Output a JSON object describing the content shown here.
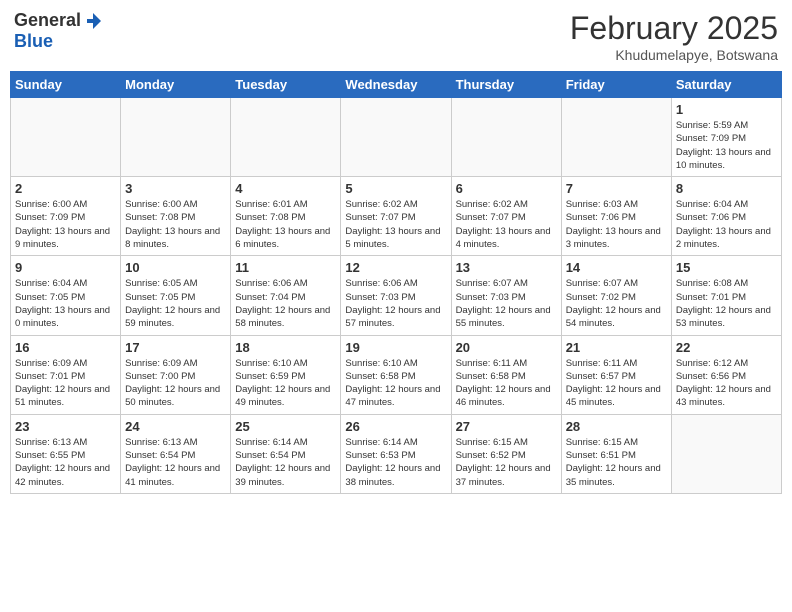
{
  "header": {
    "logo_general": "General",
    "logo_blue": "Blue",
    "month_year": "February 2025",
    "location": "Khudumelapye, Botswana"
  },
  "days_of_week": [
    "Sunday",
    "Monday",
    "Tuesday",
    "Wednesday",
    "Thursday",
    "Friday",
    "Saturday"
  ],
  "weeks": [
    [
      {
        "day": "",
        "info": ""
      },
      {
        "day": "",
        "info": ""
      },
      {
        "day": "",
        "info": ""
      },
      {
        "day": "",
        "info": ""
      },
      {
        "day": "",
        "info": ""
      },
      {
        "day": "",
        "info": ""
      },
      {
        "day": "1",
        "info": "Sunrise: 5:59 AM\nSunset: 7:09 PM\nDaylight: 13 hours\nand 10 minutes."
      }
    ],
    [
      {
        "day": "2",
        "info": "Sunrise: 6:00 AM\nSunset: 7:09 PM\nDaylight: 13 hours\nand 9 minutes."
      },
      {
        "day": "3",
        "info": "Sunrise: 6:00 AM\nSunset: 7:08 PM\nDaylight: 13 hours\nand 8 minutes."
      },
      {
        "day": "4",
        "info": "Sunrise: 6:01 AM\nSunset: 7:08 PM\nDaylight: 13 hours\nand 6 minutes."
      },
      {
        "day": "5",
        "info": "Sunrise: 6:02 AM\nSunset: 7:07 PM\nDaylight: 13 hours\nand 5 minutes."
      },
      {
        "day": "6",
        "info": "Sunrise: 6:02 AM\nSunset: 7:07 PM\nDaylight: 13 hours\nand 4 minutes."
      },
      {
        "day": "7",
        "info": "Sunrise: 6:03 AM\nSunset: 7:06 PM\nDaylight: 13 hours\nand 3 minutes."
      },
      {
        "day": "8",
        "info": "Sunrise: 6:04 AM\nSunset: 7:06 PM\nDaylight: 13 hours\nand 2 minutes."
      }
    ],
    [
      {
        "day": "9",
        "info": "Sunrise: 6:04 AM\nSunset: 7:05 PM\nDaylight: 13 hours\nand 0 minutes."
      },
      {
        "day": "10",
        "info": "Sunrise: 6:05 AM\nSunset: 7:05 PM\nDaylight: 12 hours\nand 59 minutes."
      },
      {
        "day": "11",
        "info": "Sunrise: 6:06 AM\nSunset: 7:04 PM\nDaylight: 12 hours\nand 58 minutes."
      },
      {
        "day": "12",
        "info": "Sunrise: 6:06 AM\nSunset: 7:03 PM\nDaylight: 12 hours\nand 57 minutes."
      },
      {
        "day": "13",
        "info": "Sunrise: 6:07 AM\nSunset: 7:03 PM\nDaylight: 12 hours\nand 55 minutes."
      },
      {
        "day": "14",
        "info": "Sunrise: 6:07 AM\nSunset: 7:02 PM\nDaylight: 12 hours\nand 54 minutes."
      },
      {
        "day": "15",
        "info": "Sunrise: 6:08 AM\nSunset: 7:01 PM\nDaylight: 12 hours\nand 53 minutes."
      }
    ],
    [
      {
        "day": "16",
        "info": "Sunrise: 6:09 AM\nSunset: 7:01 PM\nDaylight: 12 hours\nand 51 minutes."
      },
      {
        "day": "17",
        "info": "Sunrise: 6:09 AM\nSunset: 7:00 PM\nDaylight: 12 hours\nand 50 minutes."
      },
      {
        "day": "18",
        "info": "Sunrise: 6:10 AM\nSunset: 6:59 PM\nDaylight: 12 hours\nand 49 minutes."
      },
      {
        "day": "19",
        "info": "Sunrise: 6:10 AM\nSunset: 6:58 PM\nDaylight: 12 hours\nand 47 minutes."
      },
      {
        "day": "20",
        "info": "Sunrise: 6:11 AM\nSunset: 6:58 PM\nDaylight: 12 hours\nand 46 minutes."
      },
      {
        "day": "21",
        "info": "Sunrise: 6:11 AM\nSunset: 6:57 PM\nDaylight: 12 hours\nand 45 minutes."
      },
      {
        "day": "22",
        "info": "Sunrise: 6:12 AM\nSunset: 6:56 PM\nDaylight: 12 hours\nand 43 minutes."
      }
    ],
    [
      {
        "day": "23",
        "info": "Sunrise: 6:13 AM\nSunset: 6:55 PM\nDaylight: 12 hours\nand 42 minutes."
      },
      {
        "day": "24",
        "info": "Sunrise: 6:13 AM\nSunset: 6:54 PM\nDaylight: 12 hours\nand 41 minutes."
      },
      {
        "day": "25",
        "info": "Sunrise: 6:14 AM\nSunset: 6:54 PM\nDaylight: 12 hours\nand 39 minutes."
      },
      {
        "day": "26",
        "info": "Sunrise: 6:14 AM\nSunset: 6:53 PM\nDaylight: 12 hours\nand 38 minutes."
      },
      {
        "day": "27",
        "info": "Sunrise: 6:15 AM\nSunset: 6:52 PM\nDaylight: 12 hours\nand 37 minutes."
      },
      {
        "day": "28",
        "info": "Sunrise: 6:15 AM\nSunset: 6:51 PM\nDaylight: 12 hours\nand 35 minutes."
      },
      {
        "day": "",
        "info": ""
      }
    ]
  ]
}
